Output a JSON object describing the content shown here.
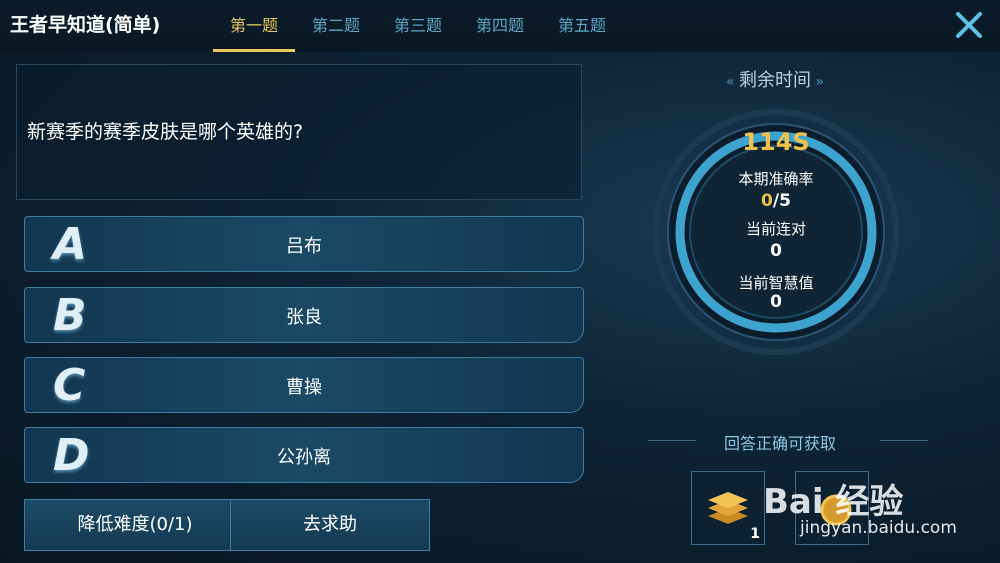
{
  "header": {
    "title": "王者早知道(简单)",
    "tabs": [
      "第一题",
      "第二题",
      "第三题",
      "第四题",
      "第五题"
    ],
    "active_tab": 0
  },
  "question": {
    "text": "新赛季的赛季皮肤是哪个英雄的?"
  },
  "options": [
    {
      "letter": "A",
      "label": "吕布"
    },
    {
      "letter": "B",
      "label": "张良"
    },
    {
      "letter": "C",
      "label": "曹操"
    },
    {
      "letter": "D",
      "label": "公孙离"
    }
  ],
  "buttons": {
    "lower_difficulty": "降低难度(0/1)",
    "ask_help": "去求助"
  },
  "timer": {
    "title": "剩余时间",
    "seconds": "114S",
    "accuracy_label": "本期准确率",
    "accuracy_correct": "0",
    "accuracy_total": "/5",
    "streak_label": "当前连对",
    "streak": "0",
    "wisdom_label": "当前智慧值",
    "wisdom": "0"
  },
  "reward": {
    "title": "回答正确可获取",
    "items": [
      {
        "icon": "coin-stack-icon",
        "count": "1"
      },
      {
        "icon": "gold-coin-icon",
        "count": ""
      }
    ]
  },
  "watermark": {
    "brand": "Bai 经验",
    "url": "jingyan.baidu.com"
  },
  "colors": {
    "accent_gold": "#e8c85a",
    "tab_inactive": "#5fa7c5",
    "ring": "#3fa3cf"
  }
}
